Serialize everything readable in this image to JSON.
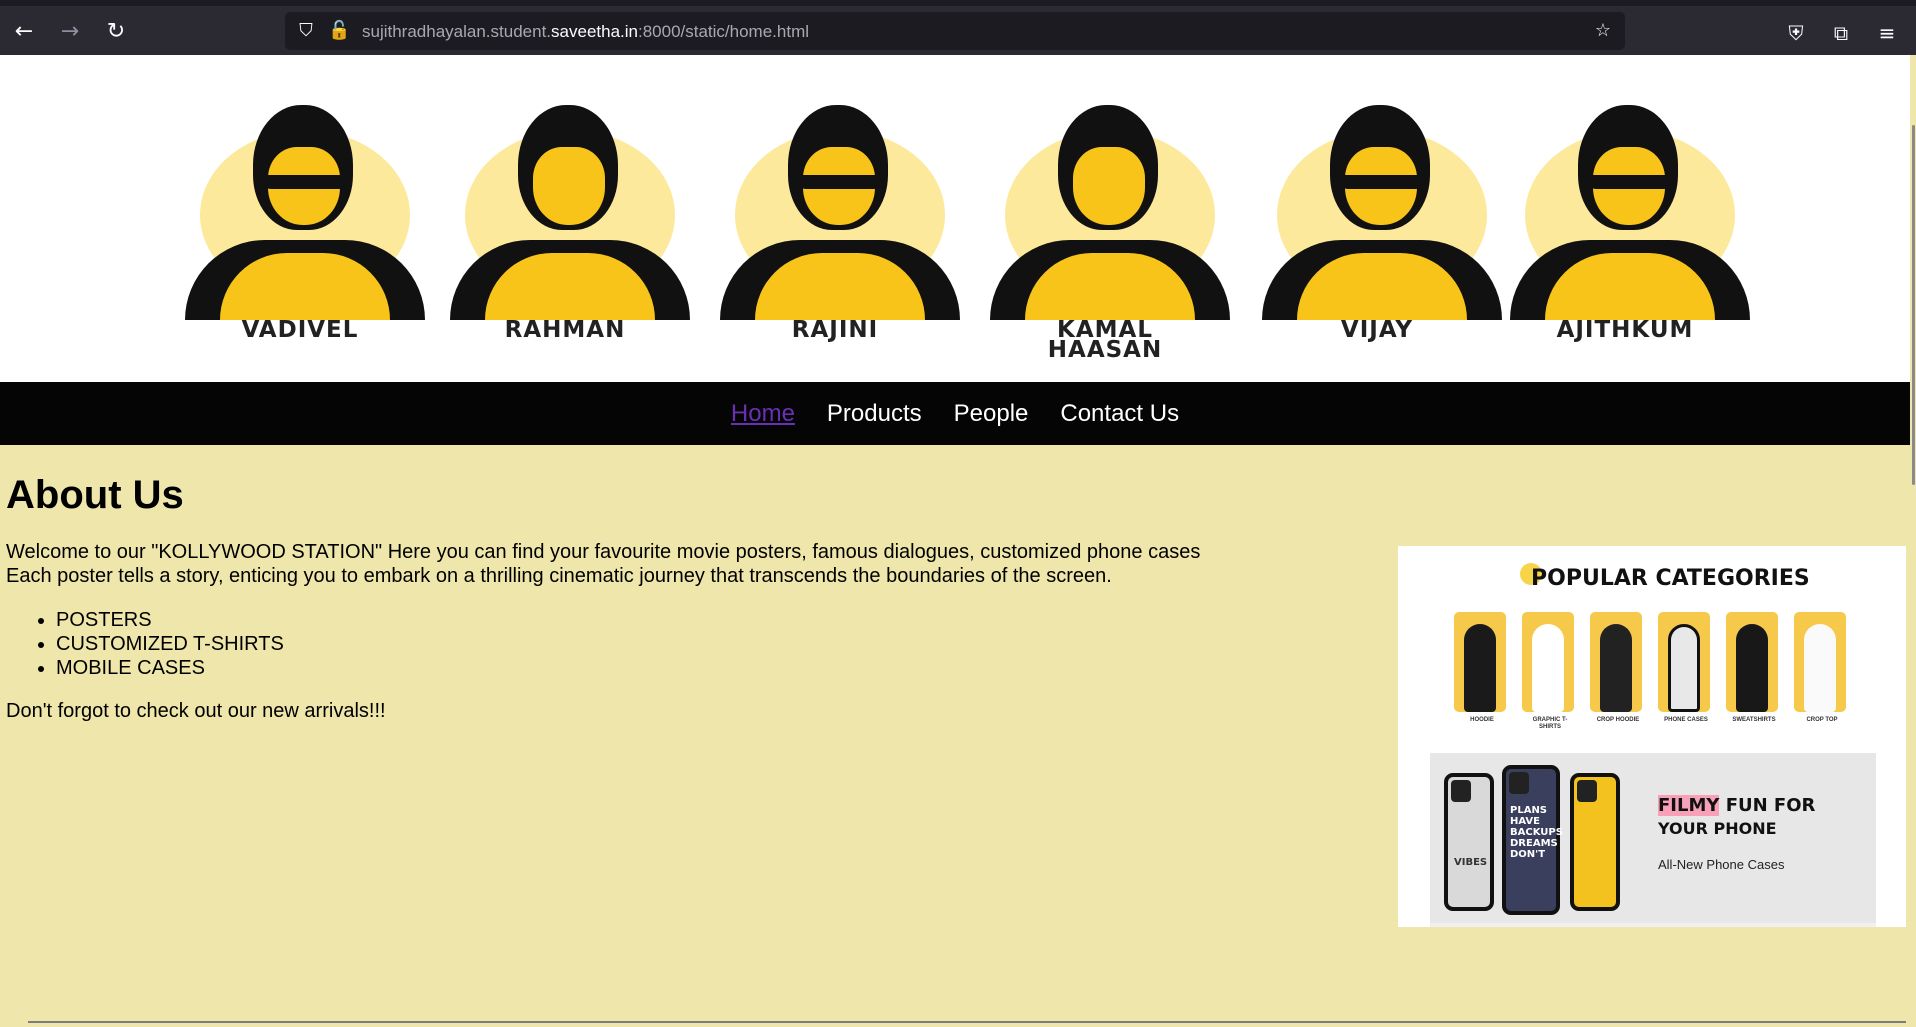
{
  "browser": {
    "url_prefix": "sujithradhayalan.student.",
    "url_host": "saveetha.in",
    "url_suffix": ":8000/static/home.html"
  },
  "banner": {
    "stars": [
      {
        "name": "VADIVEL"
      },
      {
        "name": "RAHMAN"
      },
      {
        "name": "RAJINI"
      },
      {
        "name": "KAMAL\nHAASAN"
      },
      {
        "name": "VIJAY"
      },
      {
        "name": "AJITHKUM"
      }
    ]
  },
  "nav": {
    "items": [
      {
        "label": "Home"
      },
      {
        "label": "Products"
      },
      {
        "label": "People"
      },
      {
        "label": "Contact Us"
      }
    ]
  },
  "about": {
    "title": "About Us",
    "intro_line1": "Welcome to our \"KOLLYWOOD STATION\" Here you can find your favourite movie posters, famous dialogues, customized phone cases",
    "intro_line2": "Each poster tells a story, enticing you to embark on a thrilling cinematic journey that transcends the boundaries of the screen.",
    "features": [
      "POSTERS",
      "CUSTOMIZED T-SHIRTS",
      "MOBILE CASES"
    ],
    "reminder": "Don't forgot to check out our new arrivals!!!"
  },
  "promo": {
    "title": "POPULAR CATEGORIES",
    "categories": [
      {
        "caption": "HOODIE"
      },
      {
        "caption": "GRAPHIC T-SHIRTS"
      },
      {
        "caption": "CROP HOODIE"
      },
      {
        "caption": "PHONE CASES"
      },
      {
        "caption": "SWEATSHIRTS"
      },
      {
        "caption": "CROP TOP"
      }
    ],
    "case_vibes": "VIBES",
    "case_slogan": "PLANS HAVE BACKUPS DREAMS DON'T",
    "headline_hl": "FILMY",
    "headline_rest": " FUN FOR",
    "headline_line2": "YOUR PHONE",
    "subtext": "All-New Phone Cases"
  }
}
